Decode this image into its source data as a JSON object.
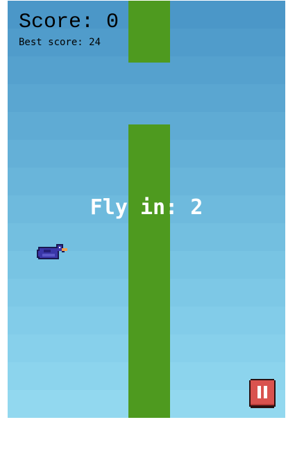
{
  "score": {
    "label": "Score: 0",
    "best_label": "Best score: 24"
  },
  "countdown": {
    "label": "Fly in: 2"
  },
  "icons": {
    "bird": "bird-sprite",
    "pause": "pause-icon"
  },
  "colors": {
    "pipe": "#4e9a1f",
    "sky_top": "#4b97c8",
    "sky_bottom": "#92d8ef",
    "bird_body": "#3a36a8",
    "bird_beak": "#f0a050",
    "pause_button": "#d9534f"
  }
}
